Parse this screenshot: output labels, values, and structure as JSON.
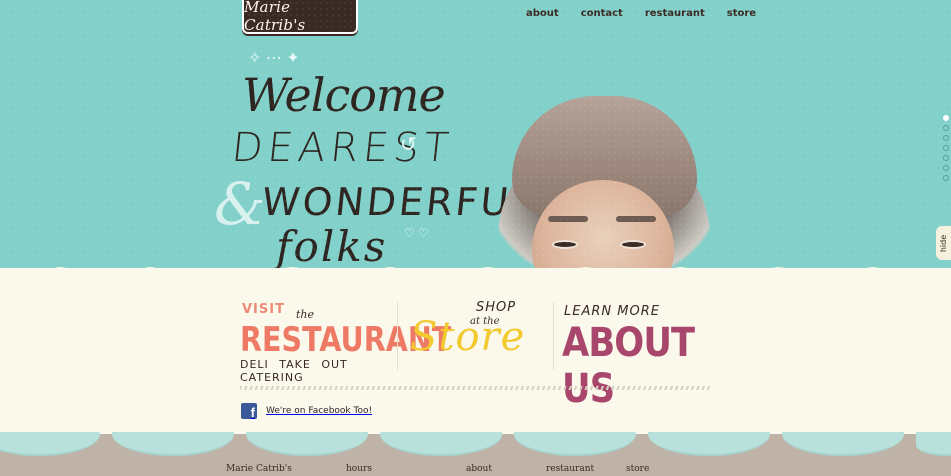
{
  "brand": {
    "logo_text": "Marie Catrib's"
  },
  "nav": {
    "items": [
      {
        "label": "about"
      },
      {
        "label": "contact"
      },
      {
        "label": "restaurant"
      },
      {
        "label": "store"
      }
    ]
  },
  "hero": {
    "line1": "Welcome",
    "line2": "DEAREST",
    "ampersand": "&",
    "line3": "WONDERFUL",
    "line4": "folks"
  },
  "promos": {
    "restaurant": {
      "visit": "VISIT",
      "the": "the",
      "title": "RESTAURANT",
      "sub": "DELI TAKE OUT CATERING"
    },
    "store": {
      "shop": "SHOP",
      "at_the": "at the",
      "title": "Store"
    },
    "about": {
      "learn": "LEARN MORE",
      "title": "ABOUT US"
    }
  },
  "facebook": {
    "label": "We're on Facebook Too!",
    "icon": "facebook-icon"
  },
  "footer": {
    "links": [
      {
        "label": "Marie Catrib's"
      },
      {
        "label": "hours"
      },
      {
        "label": "about"
      },
      {
        "label": "restaurant"
      },
      {
        "label": "store"
      }
    ]
  },
  "side": {
    "hide_label": "hide",
    "slide_count": 7,
    "active_slide": 1
  },
  "colors": {
    "teal": "#82d0ca",
    "cream": "#fbf8ec",
    "coral": "#ee7a66",
    "yellow": "#f2c92e",
    "plum": "#a8466c",
    "brown": "#3b2a24",
    "footer": "#bfb2a6"
  }
}
